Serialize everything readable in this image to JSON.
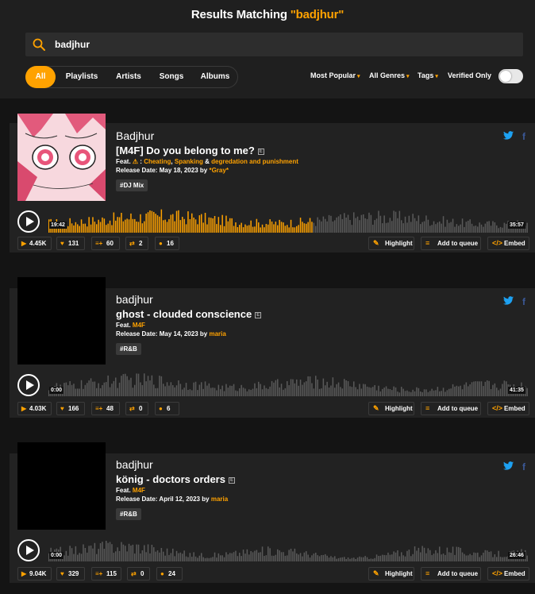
{
  "header": {
    "title_prefix": "Results Matching ",
    "query_quoted": "\"badjhur\"",
    "search_value": "badjhur",
    "tabs": [
      "All",
      "Playlists",
      "Artists",
      "Songs",
      "Albums"
    ],
    "filters": [
      "Most Popular",
      "All Genres",
      "Tags"
    ],
    "verified_label": "Verified Only",
    "accent": "#ffa200"
  },
  "actions": {
    "highlight": "Highlight",
    "queue": "Add to queue",
    "embed": "Embed"
  },
  "results": [
    {
      "artist": "Badjhur",
      "title": "[M4F] Do you belong to me?",
      "explicit": "E",
      "feat_label": "Feat.",
      "feat_parts": [
        "Cheating",
        "Spanking",
        "degredation and punishment"
      ],
      "release_label": "Release Date:",
      "release_date": "May 18, 2023",
      "by_label": "by",
      "uploader": "*Gray*",
      "tag": "#DJ Mix",
      "elapsed": "19:42",
      "duration": "35:57",
      "progress": 0.55,
      "plays": "4.45K",
      "likes": "131",
      "playlists": "60",
      "reposts": "2",
      "comments": "16"
    },
    {
      "artist": "badjhur",
      "title": "ghost - clouded conscience",
      "explicit": "E",
      "feat_label": "Feat.",
      "feat_text": "M4F",
      "release_label": "Release Date:",
      "release_date": "May 14, 2023",
      "by_label": "by",
      "uploader": "maria",
      "tag": "#R&B",
      "elapsed": "0:00",
      "duration": "41:35",
      "progress": 0,
      "plays": "4.03K",
      "likes": "166",
      "playlists": "48",
      "reposts": "0",
      "comments": "6"
    },
    {
      "artist": "badjhur",
      "title": "könig - doctors orders",
      "explicit": "E",
      "feat_label": "Feat.",
      "feat_text": "M4F",
      "release_label": "Release Date:",
      "release_date": "April 12, 2023",
      "by_label": "by",
      "uploader": "maria",
      "tag": "#R&B",
      "elapsed": "0:00",
      "duration": "26:46",
      "progress": 0,
      "plays": "9.04K",
      "likes": "329",
      "playlists": "115",
      "reposts": "0",
      "comments": "24"
    }
  ]
}
